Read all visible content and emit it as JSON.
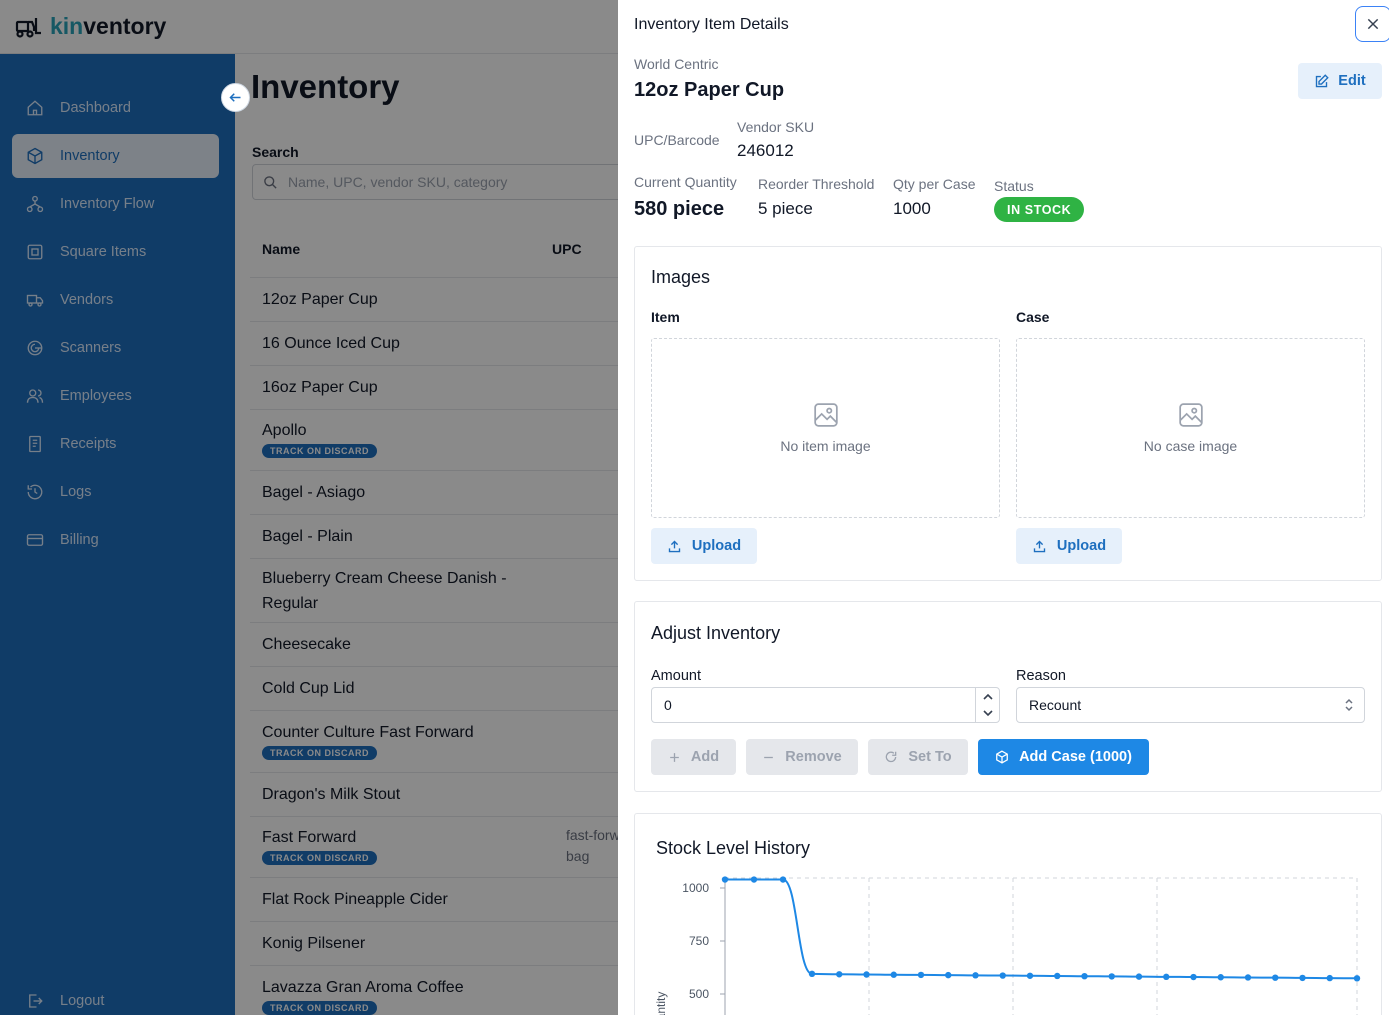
{
  "app": {
    "brand_prefix": "kin",
    "brand_suffix": "ventory"
  },
  "sidebar": {
    "items": [
      {
        "label": "Dashboard",
        "icon": "home-icon",
        "active": false
      },
      {
        "label": "Inventory",
        "icon": "box-icon",
        "active": true
      },
      {
        "label": "Inventory Flow",
        "icon": "flow-icon",
        "active": false
      },
      {
        "label": "Square Items",
        "icon": "square-icon",
        "active": false
      },
      {
        "label": "Vendors",
        "icon": "truck-icon",
        "active": false
      },
      {
        "label": "Scanners",
        "icon": "scanner-icon",
        "active": false
      },
      {
        "label": "Employees",
        "icon": "users-icon",
        "active": false
      },
      {
        "label": "Receipts",
        "icon": "receipt-icon",
        "active": false
      },
      {
        "label": "Logs",
        "icon": "history-icon",
        "active": false
      },
      {
        "label": "Billing",
        "icon": "card-icon",
        "active": false
      }
    ],
    "logout": "Logout"
  },
  "inventory": {
    "title": "Inventory",
    "search_label": "Search",
    "search_placeholder": "Name, UPC, vendor SKU, category",
    "columns": [
      "Name",
      "UPC"
    ],
    "rows": [
      {
        "name": "12oz Paper Cup",
        "badge": ""
      },
      {
        "name": "16 Ounce Iced Cup",
        "badge": ""
      },
      {
        "name": "16oz Paper Cup",
        "badge": ""
      },
      {
        "name": "Apollo",
        "badge": "TRACK ON DISCARD"
      },
      {
        "name": "Bagel - Asiago",
        "badge": ""
      },
      {
        "name": "Bagel - Plain",
        "badge": ""
      },
      {
        "name": "Blueberry Cream Cheese Danish - Regular",
        "badge": ""
      },
      {
        "name": "Cheesecake",
        "badge": ""
      },
      {
        "name": "Cold Cup Lid",
        "badge": ""
      },
      {
        "name": "Counter Culture Fast Forward",
        "badge": "TRACK ON DISCARD"
      },
      {
        "name": "Dragon's Milk Stout",
        "badge": ""
      },
      {
        "name": "Fast Forward",
        "badge": "TRACK ON DISCARD",
        "upc": "fast-forwa bag"
      },
      {
        "name": "Flat Rock Pineapple Cider",
        "badge": ""
      },
      {
        "name": "Konig Pilsener",
        "badge": ""
      },
      {
        "name": "Lavazza Gran Aroma Coffee",
        "badge": "TRACK ON DISCARD"
      }
    ]
  },
  "drawer": {
    "title": "Inventory Item Details",
    "vendor": "World Centric",
    "item_name": "12oz Paper Cup",
    "edit_label": "Edit",
    "upc_label": "UPC/Barcode",
    "sku_label": "Vendor SKU",
    "sku_value": "246012",
    "qty_label": "Current Quantity",
    "qty_value": "580 piece",
    "reorder_label": "Reorder Threshold",
    "reorder_value": "5 piece",
    "case_label": "Qty per Case",
    "case_value": "1000",
    "status_label": "Status",
    "status_value": "IN STOCK",
    "status_color": "#2fb344"
  },
  "images": {
    "title": "Images",
    "item_label": "Item",
    "case_label": "Case",
    "no_item": "No item image",
    "no_case": "No case image",
    "upload_label": "Upload"
  },
  "adjust": {
    "title": "Adjust Inventory",
    "amount_label": "Amount",
    "amount_value": "0",
    "reason_label": "Reason",
    "reason_value": "Recount",
    "add_label": "Add",
    "remove_label": "Remove",
    "setto_label": "Set To",
    "addcase_label": "Add Case (1000)"
  },
  "chart_data": {
    "type": "line",
    "title": "Stock Level History",
    "ylabel": "Quantity",
    "y_ticks": [
      500,
      750,
      1000
    ],
    "ylim": [
      480,
      1040
    ],
    "grid": true,
    "values": [
      1040,
      1040,
      1040,
      595,
      593,
      592,
      591,
      590,
      589,
      588,
      587,
      586,
      585,
      584,
      583,
      582,
      581,
      580,
      579,
      578,
      577,
      576,
      575,
      574
    ],
    "color": "#1e88e5"
  }
}
